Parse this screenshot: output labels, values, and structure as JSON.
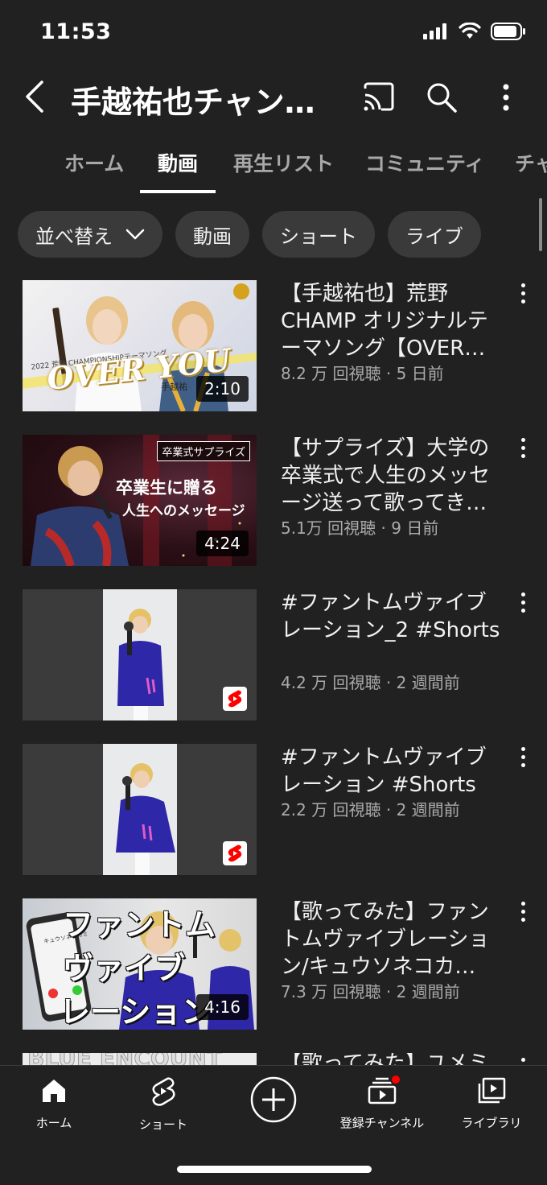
{
  "status_bar": {
    "time": "11:53"
  },
  "header": {
    "title": "手越祐也チャン…"
  },
  "tabs": [
    {
      "label": "ホーム"
    },
    {
      "label": "動画"
    },
    {
      "label": "再生リスト"
    },
    {
      "label": "コミュニティ"
    },
    {
      "label": "チャ"
    }
  ],
  "chips": [
    {
      "label": "並べ替え"
    },
    {
      "label": "動画"
    },
    {
      "label": "ショート"
    },
    {
      "label": "ライブ"
    }
  ],
  "videos": [
    {
      "title": "【手越祐也】荒野 CHAMP オリジナルテーマソング【OVER…",
      "meta": "8.2 万 回視聴 · 5 日前",
      "duration": "2:10",
      "thumb_text": "OVER YOU",
      "thumb_sub": "2022 荒野 CHAMPIONSHIPテーマソング",
      "thumb_name": "手越祐"
    },
    {
      "title": "【サプライズ】大学の卒業式で人生のメッセージ送って歌ってき…",
      "meta": "5.1万 回視聴 · 9 日前",
      "duration": "4:24",
      "thumb_tag": "卒業式サプライズ",
      "thumb_line1": "卒業生に贈る",
      "thumb_line2": "人生へのメッセージ"
    },
    {
      "title": "#ファントムヴァイブレーション_2 #Shorts",
      "meta": "4.2 万 回視聴 · 2 週間前"
    },
    {
      "title": "#ファントムヴァイブレーション #Shorts",
      "meta": "2.2 万 回視聴 · 2 週間前"
    },
    {
      "title": "【歌ってみた】ファントムヴァイブレーション/キュウソネコカ…",
      "meta": "7.3 万 回視聴 · 2 週間前",
      "duration": "4:16",
      "thumb_lines": [
        "ファントム",
        "ヴァイブ",
        "レーション"
      ],
      "phone_caller": "キュウソネコカミ"
    },
    {
      "title": "【歌ってみた】ユメミ",
      "thumb_text": "BLUE ENCOUNT"
    }
  ],
  "bottom_nav": [
    {
      "label": "ホーム",
      "icon": "home-icon"
    },
    {
      "label": "ショート",
      "icon": "shorts-icon"
    },
    {
      "label": "",
      "icon": "create-icon"
    },
    {
      "label": "登録チャンネル",
      "icon": "subscriptions-icon"
    },
    {
      "label": "ライブラリ",
      "icon": "library-icon"
    }
  ],
  "colors": {
    "background": "#212121",
    "chip": "#3a3a3a",
    "accent": "#ff0000",
    "secondary_text": "#aaaaaa"
  }
}
